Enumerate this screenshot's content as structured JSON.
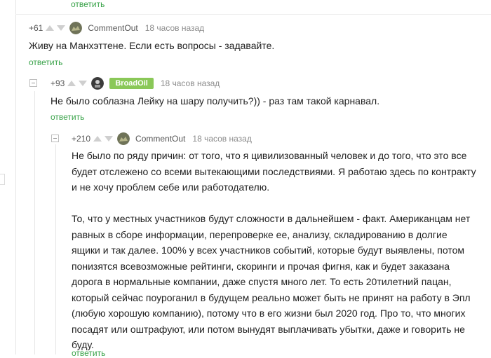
{
  "reply_label": "ответить",
  "comments": [
    {
      "rating": "+61",
      "username": "CommentOut",
      "time": "18 часов назад",
      "text": "Живу на Манхэттене. Если есть вопросы - задавайте."
    },
    {
      "rating": "+93",
      "username": "BroadOil",
      "time": "18 часов назад",
      "text": "Не было соблазна Лейку на шару получить?)) - раз там такой карнавал."
    },
    {
      "rating": "+210",
      "username": "CommentOut",
      "time": "18 часов назад",
      "paragraph1": "Не было по ряду причин: от того, что я цивилизованный человек и до того, что это все будет отслежено со всеми вытекающими последствиями. Я работаю здесь по контракту и не хочу проблем себе или работодателю.",
      "paragraph2": "То, что у местных участников будут сложности в дальнейшем - факт. Американцам нет равных в сборе информации, перепроверке ее, анализу, складированию в долгие ящики и так далее. 100% у всех участников событий, которые будут выявлены, потом понизятся всевозможные рейтинги, скоринги и прочая фигня, как и будет заказана дорога в нормальные компании, даже спустя много лет. То есть 20тилетний пацан, который сейчас поуроганил в будущем реально может быть не принят на работу в Эпл (любую хорошую компанию), потому что в его жизни был 2020 год. Про то, что многих посадят или оштрафуют, или потом вынудят выплачивать убытки, даже и говорить не буду."
    }
  ],
  "colors": {
    "reply_green": "#3aa34a",
    "badge_green": "#8ac858"
  }
}
